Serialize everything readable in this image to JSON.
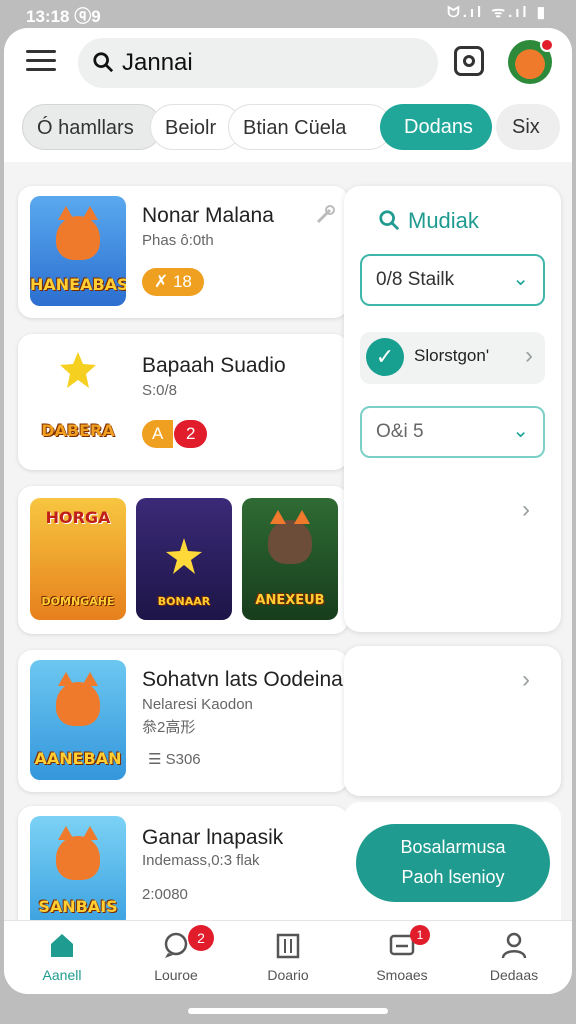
{
  "status": {
    "time": "13:18 ⓠ9",
    "icons": "ᗢ.ıl ᯤ.ıl ▮"
  },
  "search": {
    "query": "Jannai"
  },
  "chips": [
    "Ó hamllars",
    "Beiolr",
    "Btian Cüela",
    "Dodans",
    "Six"
  ],
  "cards": [
    {
      "title": "Nonar Malana",
      "subtitle": "Phas ô:0th",
      "badge": "✗ 18",
      "thumb_caption": "HANEABAS"
    },
    {
      "title": "Bapaah Suadio",
      "subtitle": "S:0/8",
      "badge_a": "A",
      "badge_b": "2",
      "thumb_caption": "DABERA"
    },
    {
      "thumb_captions": [
        "DOMNGAHE",
        "BONAAR",
        "ANEXEUB"
      ],
      "thumb_top": "HORGA"
    },
    {
      "title": "Sohatvn lats Oodeina",
      "subtitle": "Nelaresi Kaodon",
      "subtitle2": "叅2高形",
      "meta": "☰ S306",
      "thumb_caption": "AANEBAN"
    },
    {
      "title": "Ganar lnapasik",
      "subtitle": "Indemass,0:3 flak",
      "meta": "2:0080",
      "thumb_caption": "SANBAIS"
    }
  ],
  "panel": {
    "title": "Mudiak",
    "select1": "0/8 Stailk",
    "check_label": "Slorstgon'",
    "select2": "O&i 5",
    "cta_line1": "Bosalarmusa",
    "cta_line2": "Paoh lsenioy"
  },
  "nav": [
    {
      "label": "Aanell",
      "icon": "home-icon"
    },
    {
      "label": "Louroe",
      "icon": "chat-icon",
      "badge": "2"
    },
    {
      "label": "Doario",
      "icon": "building-icon"
    },
    {
      "label": "Smoaes",
      "icon": "message-icon",
      "badge": "1"
    },
    {
      "label": "Dedaas",
      "icon": "person-icon"
    }
  ],
  "colors": {
    "accent": "#1f9b8f",
    "badge_orange": "#f0a020",
    "badge_red": "#e11d2b"
  }
}
